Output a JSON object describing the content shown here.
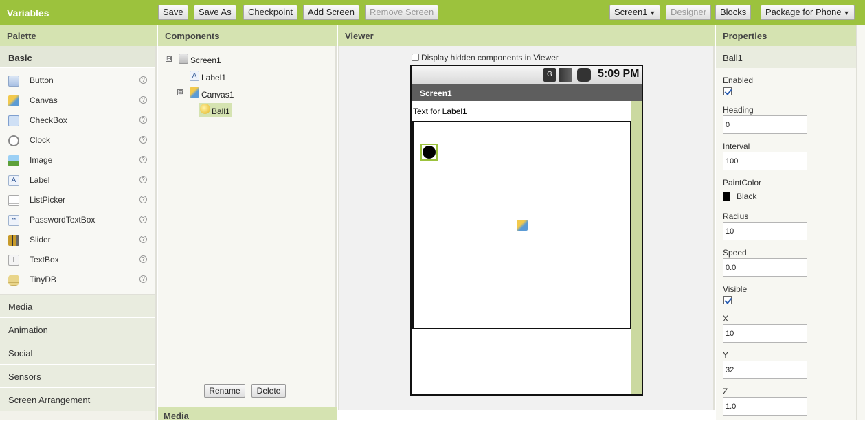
{
  "project": {
    "title": "Variables"
  },
  "toolbar": {
    "save": "Save",
    "save_as": "Save As",
    "checkpoint": "Checkpoint",
    "add_screen": "Add Screen",
    "remove_screen": "Remove Screen",
    "screen_select": "Screen1",
    "designer": "Designer",
    "blocks": "Blocks",
    "package": "Package for Phone"
  },
  "palette": {
    "title": "Palette",
    "active_section": "Basic",
    "items": [
      {
        "label": "Button",
        "icon": "button-icon"
      },
      {
        "label": "Canvas",
        "icon": "canvas-icon"
      },
      {
        "label": "CheckBox",
        "icon": "checkbox-icon"
      },
      {
        "label": "Clock",
        "icon": "clock-icon"
      },
      {
        "label": "Image",
        "icon": "image-icon"
      },
      {
        "label": "Label",
        "icon": "label-icon"
      },
      {
        "label": "ListPicker",
        "icon": "listpicker-icon"
      },
      {
        "label": "PasswordTextBox",
        "icon": "password-icon"
      },
      {
        "label": "Slider",
        "icon": "slider-icon"
      },
      {
        "label": "TextBox",
        "icon": "textbox-icon"
      },
      {
        "label": "TinyDB",
        "icon": "database-icon"
      }
    ],
    "help_glyph": "?",
    "sections": [
      "Media",
      "Animation",
      "Social",
      "Sensors",
      "Screen Arrangement"
    ]
  },
  "components": {
    "title": "Components",
    "tree": {
      "screen": "Screen1",
      "label": "Label1",
      "canvas": "Canvas1",
      "ball": "Ball1",
      "collapse_glyph": "⊟"
    },
    "rename": "Rename",
    "delete": "Delete",
    "media_title": "Media"
  },
  "viewer": {
    "title": "Viewer",
    "hidden_checkbox_label": "Display hidden components in Viewer",
    "time": "5:09 PM",
    "screen_title": "Screen1",
    "label_text": "Text for Label1"
  },
  "properties": {
    "title": "Properties",
    "component": "Ball1",
    "enabled_label": "Enabled",
    "heading_label": "Heading",
    "heading_value": "0",
    "interval_label": "Interval",
    "interval_value": "100",
    "paintcolor_label": "PaintColor",
    "paintcolor_value": "Black",
    "radius_label": "Radius",
    "radius_value": "10",
    "speed_label": "Speed",
    "speed_value": "0.0",
    "visible_label": "Visible",
    "x_label": "X",
    "x_value": "10",
    "y_label": "Y",
    "y_value": "32",
    "z_label": "Z",
    "z_value": "1.0"
  },
  "colors": {
    "accent": "#9cc23d",
    "header": "#d5e3b1",
    "selection": "#d5e3b1"
  }
}
